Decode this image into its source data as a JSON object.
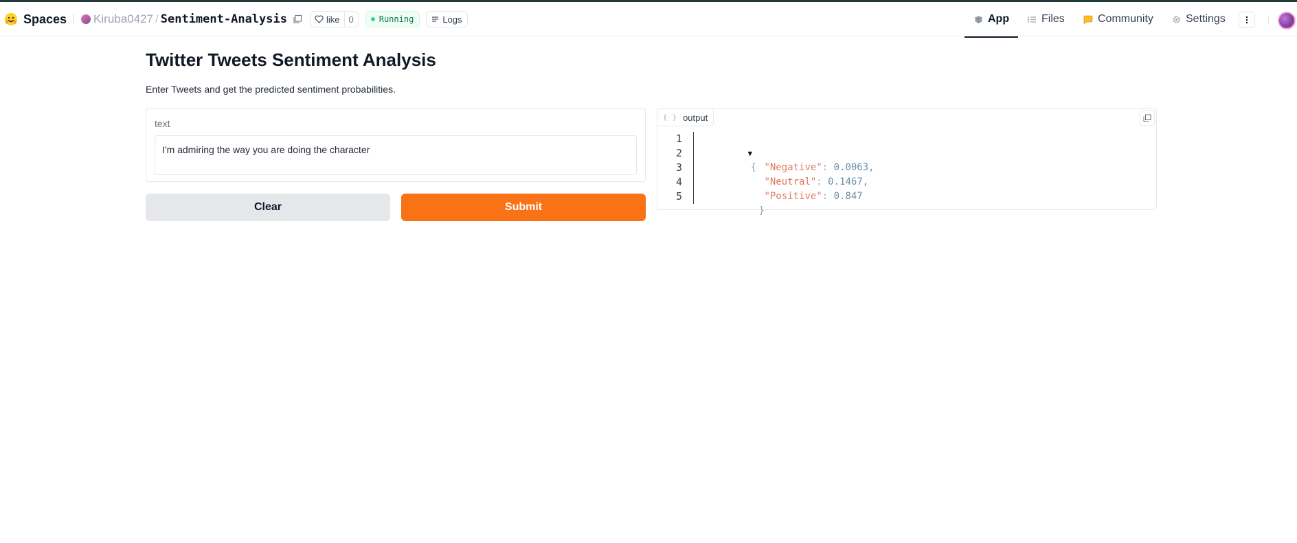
{
  "header": {
    "brand": "Spaces",
    "owner": "Kiruba0427",
    "separator": "/",
    "repo": "Sentiment-Analysis",
    "like_label": "like",
    "like_count": "0",
    "status": "Running",
    "logs_label": "Logs",
    "tabs": [
      {
        "label": "App",
        "icon": "cube-icon",
        "active": true
      },
      {
        "label": "Files",
        "icon": "files-icon",
        "active": false
      },
      {
        "label": "Community",
        "icon": "community-icon",
        "active": false
      },
      {
        "label": "Settings",
        "icon": "gear-icon",
        "active": false
      }
    ]
  },
  "app": {
    "title": "Twitter Tweets Sentiment Analysis",
    "description": "Enter Tweets and get the predicted sentiment probabilities.",
    "input_label": "text",
    "input_value": "I'm admiring the way you are doing the character",
    "clear_label": "Clear",
    "submit_label": "Submit",
    "output_label": "output",
    "output_lines": [
      {
        "num": "1",
        "key": "",
        "value": ""
      },
      {
        "num": "2",
        "key": "\"Negative\"",
        "value": "0.0063,"
      },
      {
        "num": "3",
        "key": "\"Neutral\"",
        "value": "0.1467,"
      },
      {
        "num": "4",
        "key": "\"Positive\"",
        "value": "0.847"
      },
      {
        "num": "5",
        "key": "",
        "value": ""
      }
    ],
    "open_brace": "{",
    "close_brace": "}",
    "collapse_glyph": "▼",
    "colon": ": "
  },
  "colors": {
    "accent": "#f97316",
    "running": "#047857"
  }
}
